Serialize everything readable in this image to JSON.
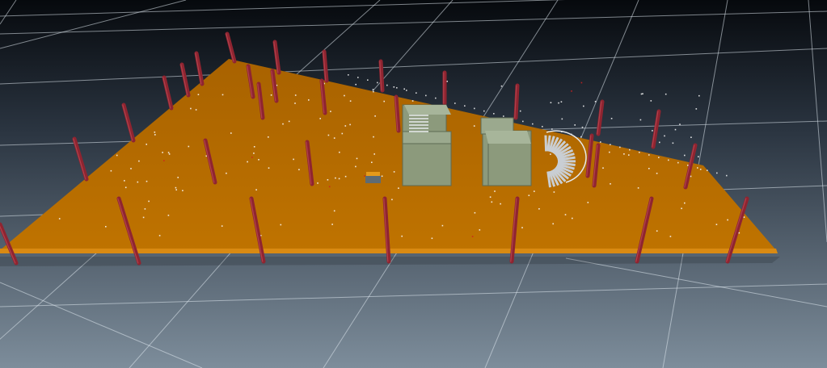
{
  "viewport": {
    "background_top": "#06090d",
    "background_bottom": "#7d8d9b",
    "grid_line_color": "#dfe7ee"
  },
  "model": {
    "slab_color": "#b86e00",
    "slab_edge_color": "#d98a12",
    "column_color": "#8f2430",
    "core_wall_color": "#8c9a7c",
    "core_top_color": "#a7b59a",
    "stair_color": "#c9ced3",
    "marker_color": "#ffffff",
    "accent_marker_color": "#d02020"
  }
}
